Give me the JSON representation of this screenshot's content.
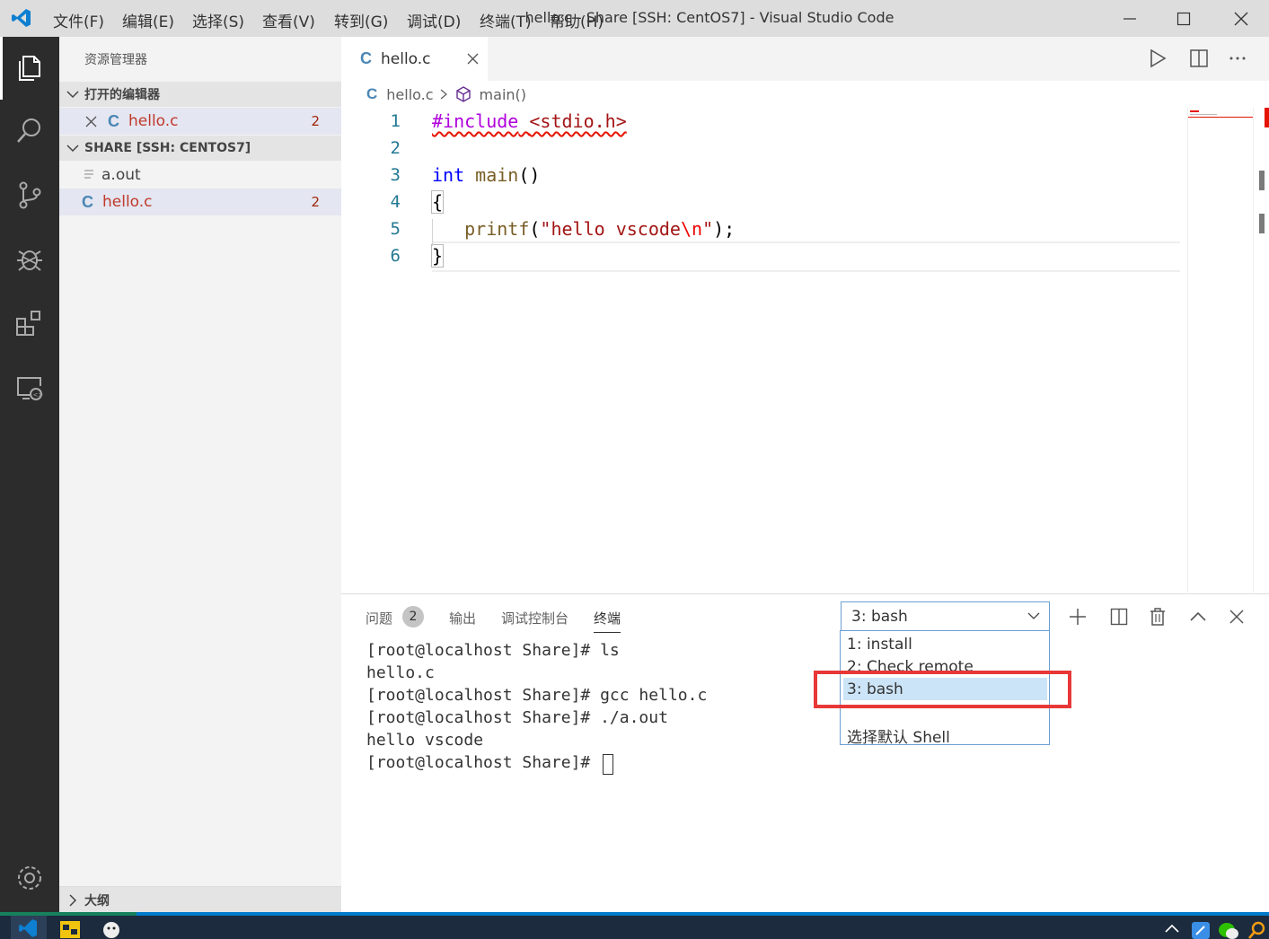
{
  "titlebar": {
    "menu": [
      "文件(F)",
      "编辑(E)",
      "选择(S)",
      "查看(V)",
      "转到(G)",
      "调试(D)",
      "终端(T)",
      "帮助(H)"
    ],
    "window_title": "hello.c - Share [SSH: CentOS7] - Visual Studio Code"
  },
  "activity_bar": {
    "icons": [
      "explorer-icon",
      "search-icon",
      "source-control-icon",
      "debug-icon",
      "extensions-icon",
      "remote-explorer-icon",
      "settings-gear-icon"
    ]
  },
  "sidebar": {
    "title": "资源管理器",
    "open_editors": {
      "header": "打开的编辑器",
      "items": [
        {
          "icon_letter": "C",
          "name": "hello.c",
          "problems": "2"
        }
      ]
    },
    "workspace": {
      "header": "SHARE [SSH: CENTOS7]",
      "files": [
        {
          "icon": "file-icon",
          "name": "a.out",
          "problems": ""
        },
        {
          "icon_letter": "C",
          "name": "hello.c",
          "problems": "2"
        }
      ]
    },
    "outline": {
      "header": "大纲"
    }
  },
  "editor": {
    "tab": {
      "icon_letter": "C",
      "label": "hello.c"
    },
    "breadcrumb": {
      "file": "hello.c",
      "symbol": "main()"
    },
    "line_numbers": [
      "1",
      "2",
      "3",
      "4",
      "5",
      "6"
    ],
    "code": {
      "l1_directive": "#include",
      "l1_header": "<stdio.h>",
      "l3_type": "int",
      "l3_name": "main",
      "l3_parens": "()",
      "l4": "{",
      "l5_fn": "printf",
      "l5_open": "(",
      "l5_str": "\"hello vscode",
      "l5_esc": "\\n",
      "l5_strend": "\"",
      "l5_close": ");",
      "l6": "}"
    }
  },
  "panel": {
    "tabs": [
      {
        "label": "问题",
        "badge": "2"
      },
      {
        "label": "输出"
      },
      {
        "label": "调试控制台"
      },
      {
        "label": "终端",
        "active": true
      }
    ],
    "terminal_lines": [
      "[root@localhost Share]# ls",
      "hello.c",
      "[root@localhost Share]# gcc hello.c",
      "[root@localhost Share]# ./a.out",
      "hello vscode",
      "[root@localhost Share]# "
    ],
    "terminal_select": {
      "value": "3: bash",
      "options": [
        "1: install",
        "2: Check remote",
        "3: bash"
      ],
      "footer_option": "选择默认 Shell"
    }
  },
  "colors": {
    "accent": "#007acc",
    "remote": "#16825d",
    "highlight_box": "#e83737",
    "error": "#a1260d"
  }
}
